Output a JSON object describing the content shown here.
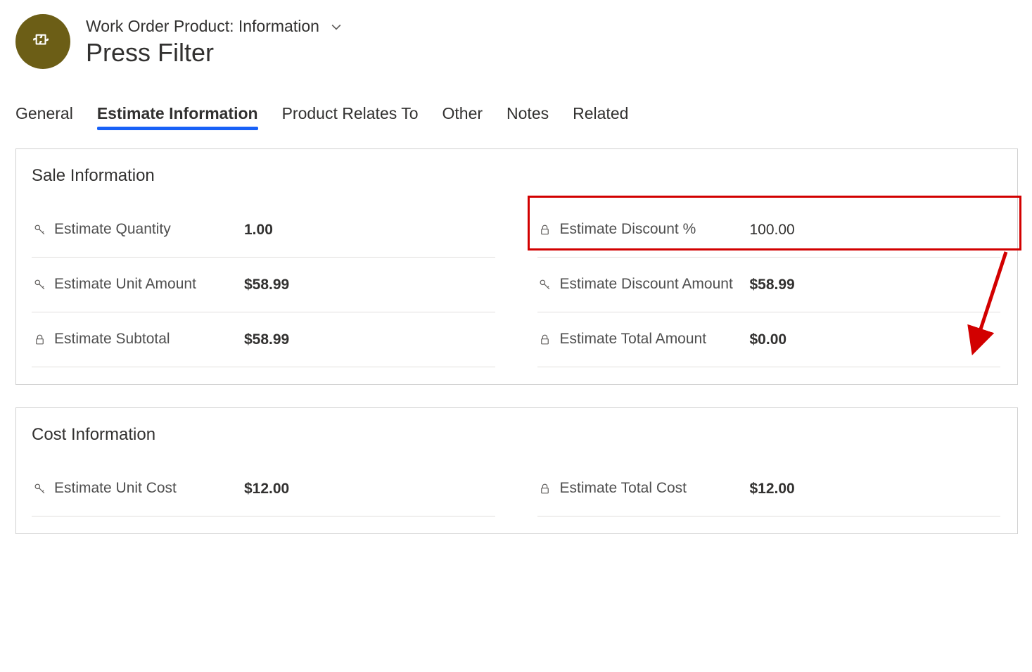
{
  "header": {
    "breadcrumb": "Work Order Product: Information",
    "title": "Press Filter"
  },
  "tabs": [
    {
      "label": "General",
      "active": false
    },
    {
      "label": "Estimate Information",
      "active": true
    },
    {
      "label": "Product Relates To",
      "active": false
    },
    {
      "label": "Other",
      "active": false
    },
    {
      "label": "Notes",
      "active": false
    },
    {
      "label": "Related",
      "active": false
    }
  ],
  "sections": {
    "sale": {
      "title": "Sale Information",
      "left": [
        {
          "icon": "key",
          "label": "Estimate Quantity",
          "value": "1.00"
        },
        {
          "icon": "key",
          "label": "Estimate Unit Amount",
          "value": "$58.99"
        },
        {
          "icon": "lock",
          "label": "Estimate Subtotal",
          "value": "$58.99"
        }
      ],
      "right": [
        {
          "icon": "lock",
          "label": "Estimate Discount %",
          "value": "100.00",
          "highlighted": true
        },
        {
          "icon": "key",
          "label": "Estimate Discount Amount",
          "value": "$58.99"
        },
        {
          "icon": "lock",
          "label": "Estimate Total Amount",
          "value": "$0.00",
          "arrow_target": true
        }
      ]
    },
    "cost": {
      "title": "Cost Information",
      "left": [
        {
          "icon": "key",
          "label": "Estimate Unit Cost",
          "value": "$12.00"
        }
      ],
      "right": [
        {
          "icon": "lock",
          "label": "Estimate Total Cost",
          "value": "$12.00"
        }
      ]
    }
  },
  "annotations": {
    "highlight_color": "#d20000",
    "arrow_color": "#d20000"
  }
}
